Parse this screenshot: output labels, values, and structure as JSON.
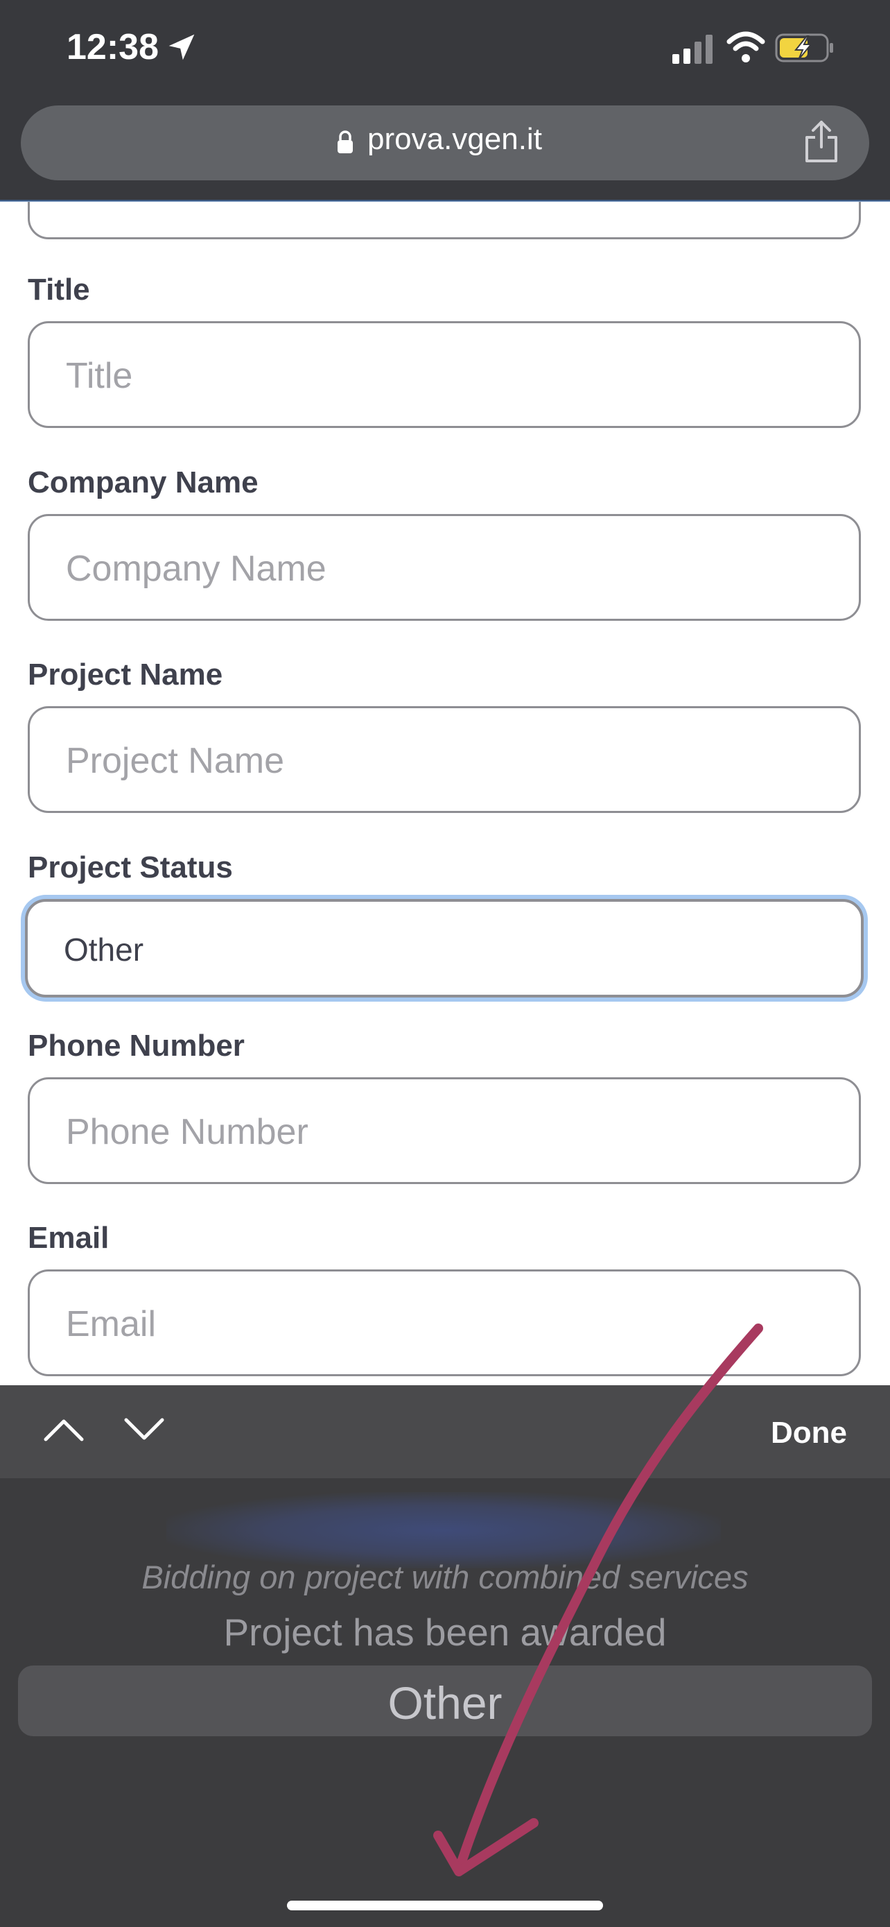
{
  "status_bar": {
    "time": "12:38"
  },
  "browser": {
    "url": "prova.vgen.it"
  },
  "form": {
    "fields": [
      {
        "label": "Title",
        "placeholder": "Title"
      },
      {
        "label": "Company Name",
        "placeholder": "Company Name"
      },
      {
        "label": "Project Name",
        "placeholder": "Project Name"
      },
      {
        "label": "Project Status",
        "value": "Other"
      },
      {
        "label": "Phone Number",
        "placeholder": "Phone Number"
      },
      {
        "label": "Email",
        "placeholder": "Email"
      }
    ]
  },
  "picker": {
    "done_label": "Done",
    "options": [
      "Bidding on project with combined services",
      "Project has been awarded",
      "Other"
    ],
    "selected": "Other"
  },
  "colors": {
    "focus_ring": "#a6c8f0",
    "annotation": "#a83a5f"
  }
}
